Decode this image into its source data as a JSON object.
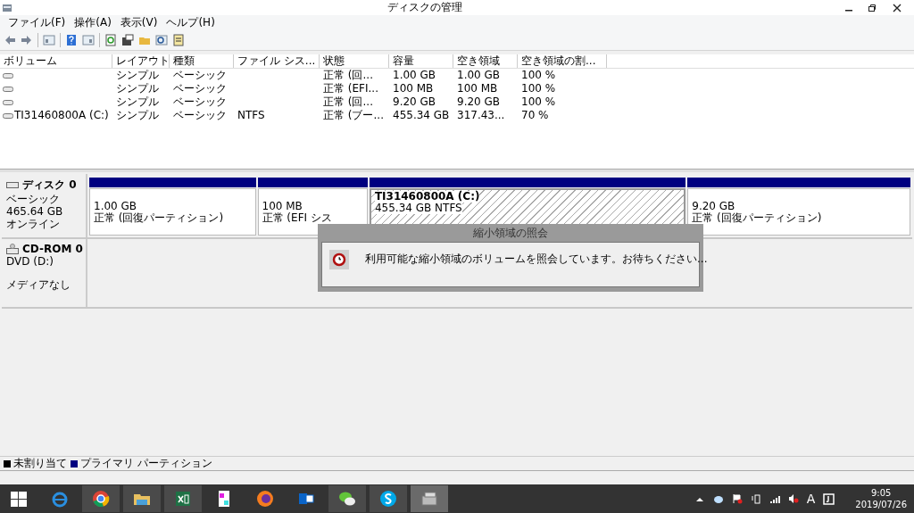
{
  "window": {
    "title": "ディスクの管理"
  },
  "menu": [
    "ファイル(F)",
    "操作(A)",
    "表示(V)",
    "ヘルプ(H)"
  ],
  "volume_table": {
    "columns": [
      "ボリューム",
      "レイアウト",
      "種類",
      "ファイル シス...",
      "状態",
      "容量",
      "空き領域",
      "空き領域の割..."
    ],
    "rows": [
      {
        "cells": [
          "",
          "シンプル",
          "ベーシック",
          "",
          "正常 (回...",
          "1.00 GB",
          "1.00 GB",
          "100 %"
        ]
      },
      {
        "cells": [
          "",
          "シンプル",
          "ベーシック",
          "",
          "正常 (EFI...",
          "100 MB",
          "100 MB",
          "100 %"
        ]
      },
      {
        "cells": [
          "",
          "シンプル",
          "ベーシック",
          "",
          "正常 (回...",
          "9.20 GB",
          "9.20 GB",
          "100 %"
        ]
      },
      {
        "cells": [
          "TI31460800A (C:)",
          "シンプル",
          "ベーシック",
          "NTFS",
          "正常 (ブー...",
          "455.34 GB",
          "317.43...",
          "70 %"
        ]
      }
    ]
  },
  "disks": [
    {
      "kind": "disk",
      "name": "ディスク 0",
      "lines": [
        "ベーシック",
        "465.64 GB",
        "オンライン"
      ],
      "partitions": [
        {
          "size": "1.00 GB",
          "status": "正常 (回復パーティション)",
          "selected": false
        },
        {
          "size": "100 MB",
          "status": "正常 (EFI シス",
          "selected": false
        },
        {
          "title": "TI31460800A  (C:)",
          "size": "455.34 GB NTFS",
          "selected": true
        },
        {
          "size": "9.20 GB",
          "status": "正常 (回復パーティション)",
          "selected": false
        }
      ]
    },
    {
      "kind": "cdrom",
      "name": "CD-ROM 0",
      "lines": [
        "DVD (D:)",
        "メディアなし"
      ]
    }
  ],
  "dialog": {
    "title": "縮小領域の照会",
    "message": "利用可能な縮小領域のボリュームを照会しています。お待ちください..."
  },
  "legend": [
    {
      "label": "未割り当て",
      "color": "#000000"
    },
    {
      "label": "プライマリ パーティション",
      "color": "#000080"
    }
  ],
  "tray": {
    "ime": "A",
    "time": "9:05",
    "date": "2019/07/26"
  }
}
